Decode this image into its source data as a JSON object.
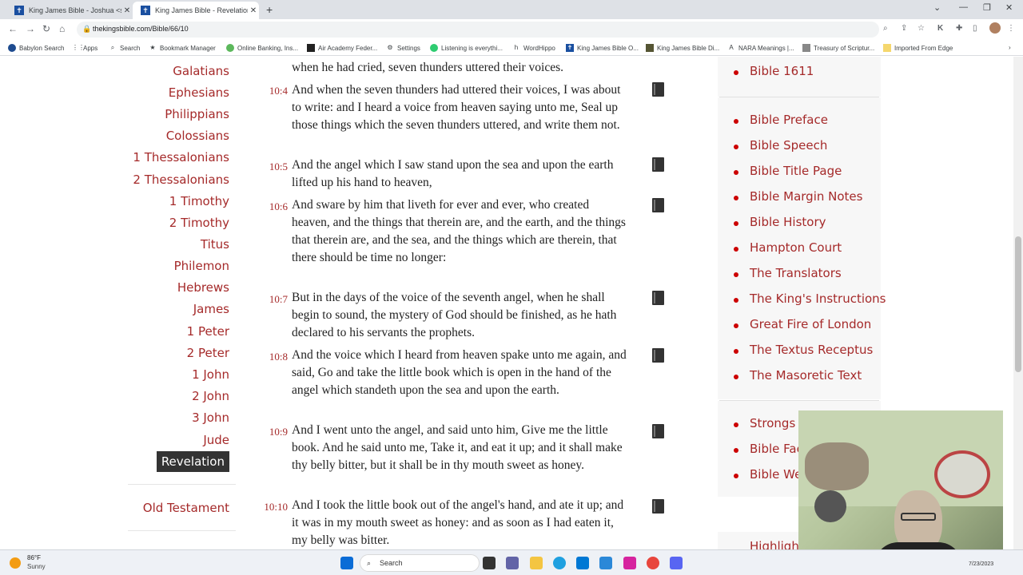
{
  "browser": {
    "tabs": [
      {
        "label": "King James Bible - Joshua <span",
        "active": false
      },
      {
        "label": "King James Bible - Revelation <s",
        "active": true
      }
    ],
    "url": "thekingsbible.com/Bible/66/10",
    "bookmarks": [
      "Babylon Search",
      "Apps",
      "Search",
      "Bookmark Manager",
      "Online Banking, Ins...",
      "Air Academy Feder...",
      "Settings",
      "Listening is everythi...",
      "WordHippo",
      "King James Bible O...",
      "King James Bible Di...",
      "NARA Meanings |...",
      "Treasury of Scriptur...",
      "Imported From Edge"
    ]
  },
  "books_nav": {
    "books": [
      "Galatians",
      "Ephesians",
      "Philippians",
      "Colossians",
      "1 Thessalonians",
      "2 Thessalonians",
      "1 Timothy",
      "2 Timothy",
      "Titus",
      "Philemon",
      "Hebrews",
      "James",
      "1 Peter",
      "2 Peter",
      "1 John",
      "2 John",
      "3 John",
      "Jude",
      "Revelation"
    ],
    "active": "Revelation",
    "old_testament": "Old Testament"
  },
  "verses": [
    {
      "ref": "",
      "text": "when he had cried, seven thunders uttered their voices."
    },
    {
      "ref": "10:4",
      "text": "And when the seven thunders had uttered their voices, I was about to write: and I heard a voice from heaven saying unto me, Seal up those things which the seven thunders uttered, and write them not."
    },
    {
      "ref": "10:5",
      "text": "And the angel which I saw stand upon the sea and upon the earth lifted up his hand to heaven,"
    },
    {
      "ref": "10:6",
      "text": "And sware by him that liveth for ever and ever, who created heaven, and the things that therein are, and the earth, and the things that therein are, and the sea, and the things which are therein, that there should be time no longer:"
    },
    {
      "ref": "10:7",
      "text": "But in the days of the voice of the seventh angel, when he shall begin to sound, the mystery of God should be finished, as he hath declared to his servants the prophets."
    },
    {
      "ref": "10:8",
      "text": "And the voice which I heard from heaven spake unto me again, and said, Go and take the little book which is open in the hand of the angel which standeth upon the sea and upon the earth."
    },
    {
      "ref": "10:9",
      "text": "And I went unto the angel, and said unto him, Give me the little book. And he said unto me, Take it, and eat it up; and it shall make thy belly bitter, but it shall be in thy mouth sweet as honey."
    },
    {
      "ref": "10:10",
      "text": "And I took the little book out of the angel's hand, and ate it up; and it was in my mouth sweet as honey: and as soon as I had eaten it, my belly was bitter."
    }
  ],
  "sidebar": {
    "top_link": "Bible 1611",
    "links": [
      "Bible Preface",
      "Bible Speech",
      "Bible Title Page",
      "Bible Margin Notes",
      "Bible History",
      "Hampton Court",
      "The Translators",
      "The King's Instructions",
      "Great Fire of London",
      "The Textus Receptus",
      "The Masoretic Text"
    ],
    "links2": [
      "Strongs N",
      "Bible Fac",
      "Bible We"
    ],
    "partial_heading": "Highlight"
  },
  "taskbar": {
    "temp": "86°F",
    "condition": "Sunny",
    "search_label": "Search",
    "date": "7/23/2023"
  }
}
